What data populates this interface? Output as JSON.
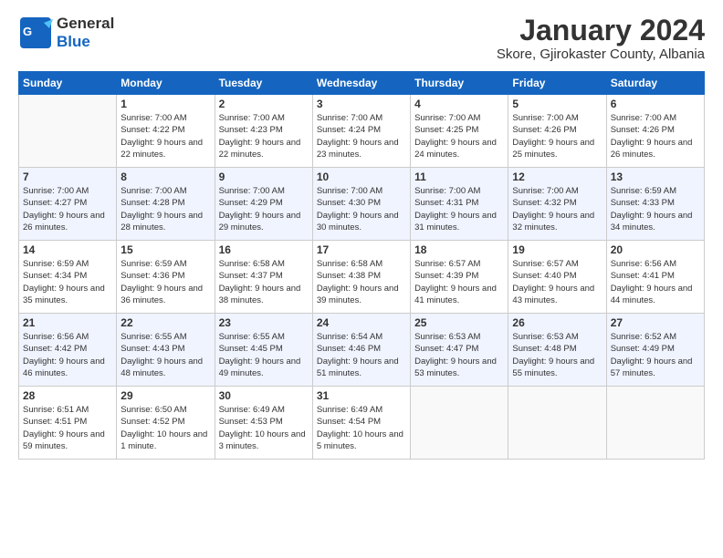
{
  "header": {
    "logo_line1": "General",
    "logo_line2": "Blue",
    "title": "January 2024",
    "subtitle": "Skore, Gjirokaster County, Albania"
  },
  "calendar": {
    "days_of_week": [
      "Sunday",
      "Monday",
      "Tuesday",
      "Wednesday",
      "Thursday",
      "Friday",
      "Saturday"
    ],
    "weeks": [
      [
        {
          "day": "",
          "sunrise": "",
          "sunset": "",
          "daylight": ""
        },
        {
          "day": "1",
          "sunrise": "Sunrise: 7:00 AM",
          "sunset": "Sunset: 4:22 PM",
          "daylight": "Daylight: 9 hours and 22 minutes."
        },
        {
          "day": "2",
          "sunrise": "Sunrise: 7:00 AM",
          "sunset": "Sunset: 4:23 PM",
          "daylight": "Daylight: 9 hours and 22 minutes."
        },
        {
          "day": "3",
          "sunrise": "Sunrise: 7:00 AM",
          "sunset": "Sunset: 4:24 PM",
          "daylight": "Daylight: 9 hours and 23 minutes."
        },
        {
          "day": "4",
          "sunrise": "Sunrise: 7:00 AM",
          "sunset": "Sunset: 4:25 PM",
          "daylight": "Daylight: 9 hours and 24 minutes."
        },
        {
          "day": "5",
          "sunrise": "Sunrise: 7:00 AM",
          "sunset": "Sunset: 4:26 PM",
          "daylight": "Daylight: 9 hours and 25 minutes."
        },
        {
          "day": "6",
          "sunrise": "Sunrise: 7:00 AM",
          "sunset": "Sunset: 4:26 PM",
          "daylight": "Daylight: 9 hours and 26 minutes."
        }
      ],
      [
        {
          "day": "7",
          "sunrise": "Sunrise: 7:00 AM",
          "sunset": "Sunset: 4:27 PM",
          "daylight": "Daylight: 9 hours and 26 minutes."
        },
        {
          "day": "8",
          "sunrise": "Sunrise: 7:00 AM",
          "sunset": "Sunset: 4:28 PM",
          "daylight": "Daylight: 9 hours and 28 minutes."
        },
        {
          "day": "9",
          "sunrise": "Sunrise: 7:00 AM",
          "sunset": "Sunset: 4:29 PM",
          "daylight": "Daylight: 9 hours and 29 minutes."
        },
        {
          "day": "10",
          "sunrise": "Sunrise: 7:00 AM",
          "sunset": "Sunset: 4:30 PM",
          "daylight": "Daylight: 9 hours and 30 minutes."
        },
        {
          "day": "11",
          "sunrise": "Sunrise: 7:00 AM",
          "sunset": "Sunset: 4:31 PM",
          "daylight": "Daylight: 9 hours and 31 minutes."
        },
        {
          "day": "12",
          "sunrise": "Sunrise: 7:00 AM",
          "sunset": "Sunset: 4:32 PM",
          "daylight": "Daylight: 9 hours and 32 minutes."
        },
        {
          "day": "13",
          "sunrise": "Sunrise: 6:59 AM",
          "sunset": "Sunset: 4:33 PM",
          "daylight": "Daylight: 9 hours and 34 minutes."
        }
      ],
      [
        {
          "day": "14",
          "sunrise": "Sunrise: 6:59 AM",
          "sunset": "Sunset: 4:34 PM",
          "daylight": "Daylight: 9 hours and 35 minutes."
        },
        {
          "day": "15",
          "sunrise": "Sunrise: 6:59 AM",
          "sunset": "Sunset: 4:36 PM",
          "daylight": "Daylight: 9 hours and 36 minutes."
        },
        {
          "day": "16",
          "sunrise": "Sunrise: 6:58 AM",
          "sunset": "Sunset: 4:37 PM",
          "daylight": "Daylight: 9 hours and 38 minutes."
        },
        {
          "day": "17",
          "sunrise": "Sunrise: 6:58 AM",
          "sunset": "Sunset: 4:38 PM",
          "daylight": "Daylight: 9 hours and 39 minutes."
        },
        {
          "day": "18",
          "sunrise": "Sunrise: 6:57 AM",
          "sunset": "Sunset: 4:39 PM",
          "daylight": "Daylight: 9 hours and 41 minutes."
        },
        {
          "day": "19",
          "sunrise": "Sunrise: 6:57 AM",
          "sunset": "Sunset: 4:40 PM",
          "daylight": "Daylight: 9 hours and 43 minutes."
        },
        {
          "day": "20",
          "sunrise": "Sunrise: 6:56 AM",
          "sunset": "Sunset: 4:41 PM",
          "daylight": "Daylight: 9 hours and 44 minutes."
        }
      ],
      [
        {
          "day": "21",
          "sunrise": "Sunrise: 6:56 AM",
          "sunset": "Sunset: 4:42 PM",
          "daylight": "Daylight: 9 hours and 46 minutes."
        },
        {
          "day": "22",
          "sunrise": "Sunrise: 6:55 AM",
          "sunset": "Sunset: 4:43 PM",
          "daylight": "Daylight: 9 hours and 48 minutes."
        },
        {
          "day": "23",
          "sunrise": "Sunrise: 6:55 AM",
          "sunset": "Sunset: 4:45 PM",
          "daylight": "Daylight: 9 hours and 49 minutes."
        },
        {
          "day": "24",
          "sunrise": "Sunrise: 6:54 AM",
          "sunset": "Sunset: 4:46 PM",
          "daylight": "Daylight: 9 hours and 51 minutes."
        },
        {
          "day": "25",
          "sunrise": "Sunrise: 6:53 AM",
          "sunset": "Sunset: 4:47 PM",
          "daylight": "Daylight: 9 hours and 53 minutes."
        },
        {
          "day": "26",
          "sunrise": "Sunrise: 6:53 AM",
          "sunset": "Sunset: 4:48 PM",
          "daylight": "Daylight: 9 hours and 55 minutes."
        },
        {
          "day": "27",
          "sunrise": "Sunrise: 6:52 AM",
          "sunset": "Sunset: 4:49 PM",
          "daylight": "Daylight: 9 hours and 57 minutes."
        }
      ],
      [
        {
          "day": "28",
          "sunrise": "Sunrise: 6:51 AM",
          "sunset": "Sunset: 4:51 PM",
          "daylight": "Daylight: 9 hours and 59 minutes."
        },
        {
          "day": "29",
          "sunrise": "Sunrise: 6:50 AM",
          "sunset": "Sunset: 4:52 PM",
          "daylight": "Daylight: 10 hours and 1 minute."
        },
        {
          "day": "30",
          "sunrise": "Sunrise: 6:49 AM",
          "sunset": "Sunset: 4:53 PM",
          "daylight": "Daylight: 10 hours and 3 minutes."
        },
        {
          "day": "31",
          "sunrise": "Sunrise: 6:49 AM",
          "sunset": "Sunset: 4:54 PM",
          "daylight": "Daylight: 10 hours and 5 minutes."
        },
        {
          "day": "",
          "sunrise": "",
          "sunset": "",
          "daylight": ""
        },
        {
          "day": "",
          "sunrise": "",
          "sunset": "",
          "daylight": ""
        },
        {
          "day": "",
          "sunrise": "",
          "sunset": "",
          "daylight": ""
        }
      ]
    ]
  }
}
